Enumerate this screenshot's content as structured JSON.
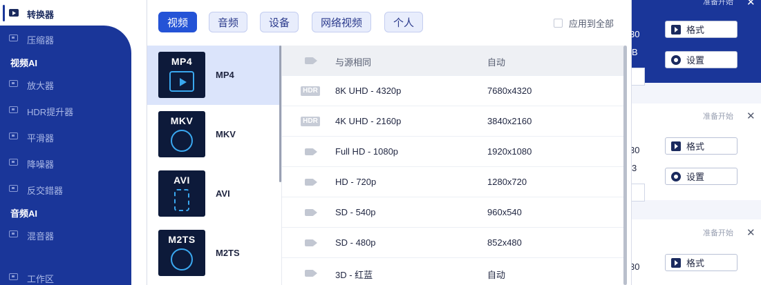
{
  "sidebar": {
    "top_item": "转换器",
    "items": [
      {
        "label": "压缩器"
      },
      {
        "label": "放大器"
      },
      {
        "label": "HDR提升器"
      },
      {
        "label": "平滑器"
      },
      {
        "label": "降噪器"
      },
      {
        "label": "反交錯器"
      },
      {
        "label": "混音器"
      },
      {
        "label": "工作区"
      }
    ],
    "sections": {
      "video_ai": "视频AI",
      "audio_ai": "音频AI"
    }
  },
  "dialog": {
    "tabs": [
      {
        "label": "视频",
        "active": true
      },
      {
        "label": "音频"
      },
      {
        "label": "设备"
      },
      {
        "label": "网络视频"
      },
      {
        "label": "个人"
      }
    ],
    "apply_all": "应用到全部",
    "formats": [
      {
        "thumb": "MP4",
        "label": "MP4",
        "selected": true
      },
      {
        "thumb": "MKV",
        "label": "MKV"
      },
      {
        "thumb": "AVI",
        "label": "AVI"
      },
      {
        "thumb": "M2TS",
        "label": "M2TS"
      }
    ],
    "resolutions": [
      {
        "icon": "camera-icon",
        "name": "与源相同",
        "size": "自动"
      },
      {
        "icon": "hdr-icon",
        "badge": "HDR",
        "name": "8K UHD - 4320p",
        "size": "7680x4320"
      },
      {
        "icon": "hdr-icon",
        "badge": "HDR",
        "name": "4K UHD - 2160p",
        "size": "3840x2160"
      },
      {
        "icon": "camera-icon",
        "name": "Full HD - 1080p",
        "size": "1920x1080"
      },
      {
        "icon": "camera-icon",
        "name": "HD - 720p",
        "size": "1280x720"
      },
      {
        "icon": "camera-icon",
        "name": "SD - 540p",
        "size": "960x540"
      },
      {
        "icon": "camera-icon",
        "name": "SD - 480p",
        "size": "852x480"
      },
      {
        "icon": "camera-icon",
        "name": "3D - 红蓝",
        "size": "自动"
      }
    ]
  },
  "cards": [
    {
      "status": "准备开始",
      "format_btn": "格式",
      "settings_btn": "设置",
      "peek_a": "30",
      "peek_b": "B"
    },
    {
      "status": "准备开始",
      "format_btn": "格式",
      "settings_btn": "设置",
      "peek_a": "30",
      "peek_b": "3"
    },
    {
      "status": "准备开始",
      "format_btn": "格式",
      "peek_a": "30"
    }
  ],
  "colors": {
    "accent": "#2453d6",
    "sidebar": "#1a3699",
    "selected_row": "#dbe4fb"
  }
}
